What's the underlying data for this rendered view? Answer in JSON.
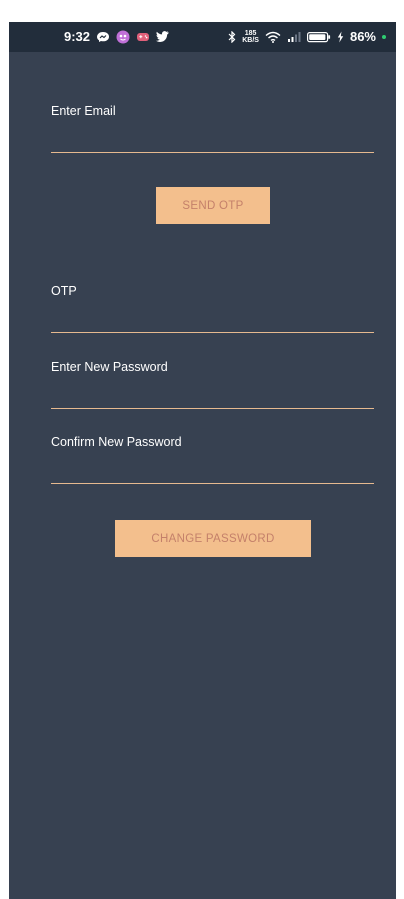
{
  "status_bar": {
    "time": "9:32",
    "network_speed_value": "185",
    "network_speed_unit": "KB/S",
    "battery_percent": "86%",
    "icons": [
      "messenger-icon",
      "avatar-icon",
      "game-icon",
      "twitter-icon",
      "bluetooth-icon",
      "wifi-icon",
      "signal-icon",
      "battery-icon",
      "charging-icon"
    ]
  },
  "form": {
    "email_label": "Enter Email",
    "email_value": "",
    "send_otp_label": "SEND OTP",
    "otp_label": "OTP",
    "otp_value": "",
    "new_password_label": "Enter New Password",
    "new_password_value": "",
    "confirm_password_label": "Confirm New Password",
    "confirm_password_value": "",
    "change_password_label": "CHANGE PASSWORD"
  },
  "colors": {
    "background": "#374151",
    "status_bar": "#222d3b",
    "accent": "#f3bf8d",
    "button_text": "#c4806a",
    "underline": "#e6b98f"
  }
}
